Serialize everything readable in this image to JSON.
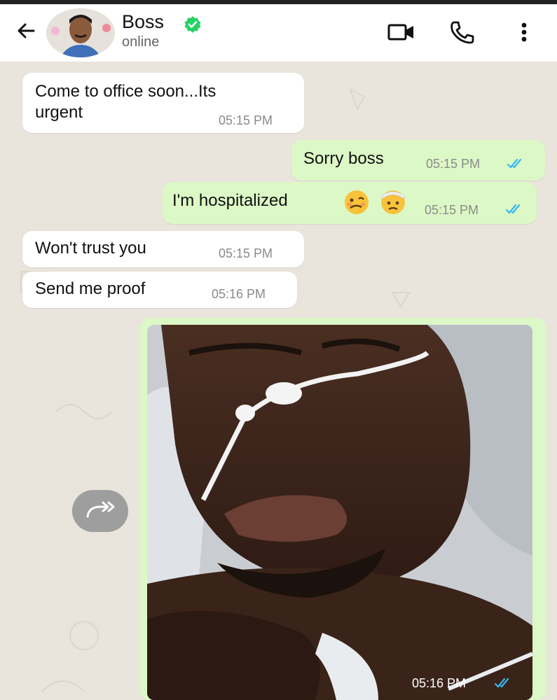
{
  "header": {
    "contact_name": "Boss",
    "status": "online",
    "icons": [
      "back-arrow-icon",
      "verified-badge-icon",
      "video-call-icon",
      "phone-icon",
      "more-options-icon"
    ]
  },
  "messages": [
    {
      "direction": "incoming",
      "text_line1": "Come to office soon...Its",
      "text_line2": "urgent",
      "time": "05:15 PM"
    },
    {
      "direction": "outgoing",
      "text": "Sorry boss",
      "time": "05:15 PM",
      "status": "read"
    },
    {
      "direction": "outgoing",
      "text": "I'm hospitalized",
      "emojis": [
        "woozy-face-icon",
        "face-with-head-bandage-icon"
      ],
      "time": "05:15 PM",
      "status": "read"
    },
    {
      "direction": "incoming",
      "text": "Won't trust you",
      "time": "05:15 PM"
    },
    {
      "direction": "incoming",
      "text": "Send me proof",
      "time": "05:16 PM"
    },
    {
      "direction": "outgoing",
      "type": "image",
      "time": "05:16 PM",
      "status": "read"
    }
  ],
  "colors": {
    "outgoing_bubble": "#dcf8c6",
    "incoming_bubble": "#ffffff",
    "chat_bg": "#e9e4dc",
    "read_tick": "#34b7f1",
    "verified": "#25d366"
  }
}
